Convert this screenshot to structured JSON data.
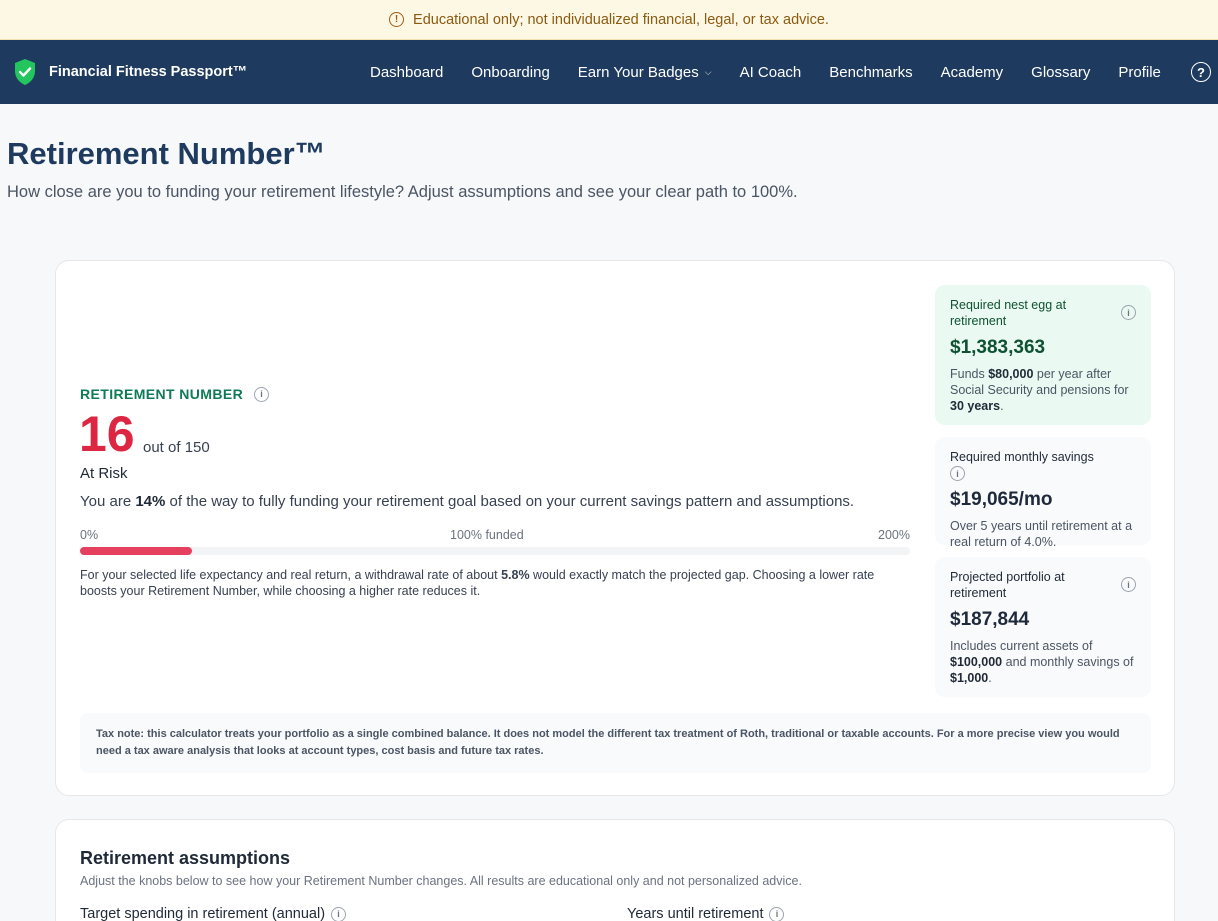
{
  "disclaimer": {
    "text": "Educational only; not individualized financial, legal, or tax advice.",
    "icon": "warning-circle-icon"
  },
  "brand": {
    "name": "Financial Fitness Passport™",
    "accent": "#22c55e"
  },
  "nav": {
    "items": [
      {
        "label": "Dashboard"
      },
      {
        "label": "Onboarding"
      },
      {
        "label": "Earn Your Badges",
        "has_dropdown": true
      },
      {
        "label": "AI Coach"
      },
      {
        "label": "Benchmarks"
      },
      {
        "label": "Academy"
      },
      {
        "label": "Glossary"
      },
      {
        "label": "Profile"
      }
    ],
    "help_glyph": "?"
  },
  "page": {
    "title": "Retirement Number™",
    "subtitle": "How close are you to funding your retirement lifestyle? Adjust assumptions and see your clear path to 100%."
  },
  "score": {
    "label": "RETIREMENT NUMBER",
    "value": "16",
    "out_of": "out of 150",
    "status": "At Risk",
    "progress_prefix": "You are ",
    "progress_pct": "14%",
    "progress_suffix": " of the way to fully funding your retirement goal based on your current savings pattern and assumptions.",
    "bar": {
      "min_label": "0%",
      "mid_label": "100% funded",
      "max_label": "200%",
      "fill_fraction_of_max": 0.135,
      "color": "#e5405e"
    },
    "note_prefix": "For your selected life expectancy and real return, a withdrawal rate of about ",
    "note_rate": "5.8%",
    "note_suffix": " would exactly match the projected gap. Choosing a lower rate boosts your Retirement Number, while choosing a higher rate reduces it."
  },
  "stats": {
    "nest_egg": {
      "title": "Required nest egg at retirement",
      "value": "$1,383,363",
      "desc_1": "Funds ",
      "desc_amount": "$80,000",
      "desc_2": " per year after Social Security and pensions for ",
      "desc_years": "30 years",
      "desc_3": "."
    },
    "monthly": {
      "title": "Required monthly savings",
      "value": "$19,065/mo",
      "desc": "Over 5 years until retirement at a real return of 4.0%."
    },
    "portfolio": {
      "title": "Projected portfolio at retirement",
      "value": "$187,844",
      "desc_1": "Includes current assets of ",
      "desc_assets": "$100,000",
      "desc_2": " and monthly savings of ",
      "desc_savings": "$1,000",
      "desc_3": "."
    }
  },
  "tax_note": "Tax note: this calculator treats your portfolio as a single combined balance. It does not model the different tax treatment of Roth, traditional or taxable accounts. For a more precise view you would need a tax aware analysis that looks at account types, cost basis and future tax rates.",
  "assumptions": {
    "title": "Retirement assumptions",
    "subtitle": "Adjust the knobs below to see how your Retirement Number changes. All results are educational only and not personalized advice.",
    "field_1": "Target spending in retirement (annual)",
    "field_2": "Years until retirement"
  }
}
